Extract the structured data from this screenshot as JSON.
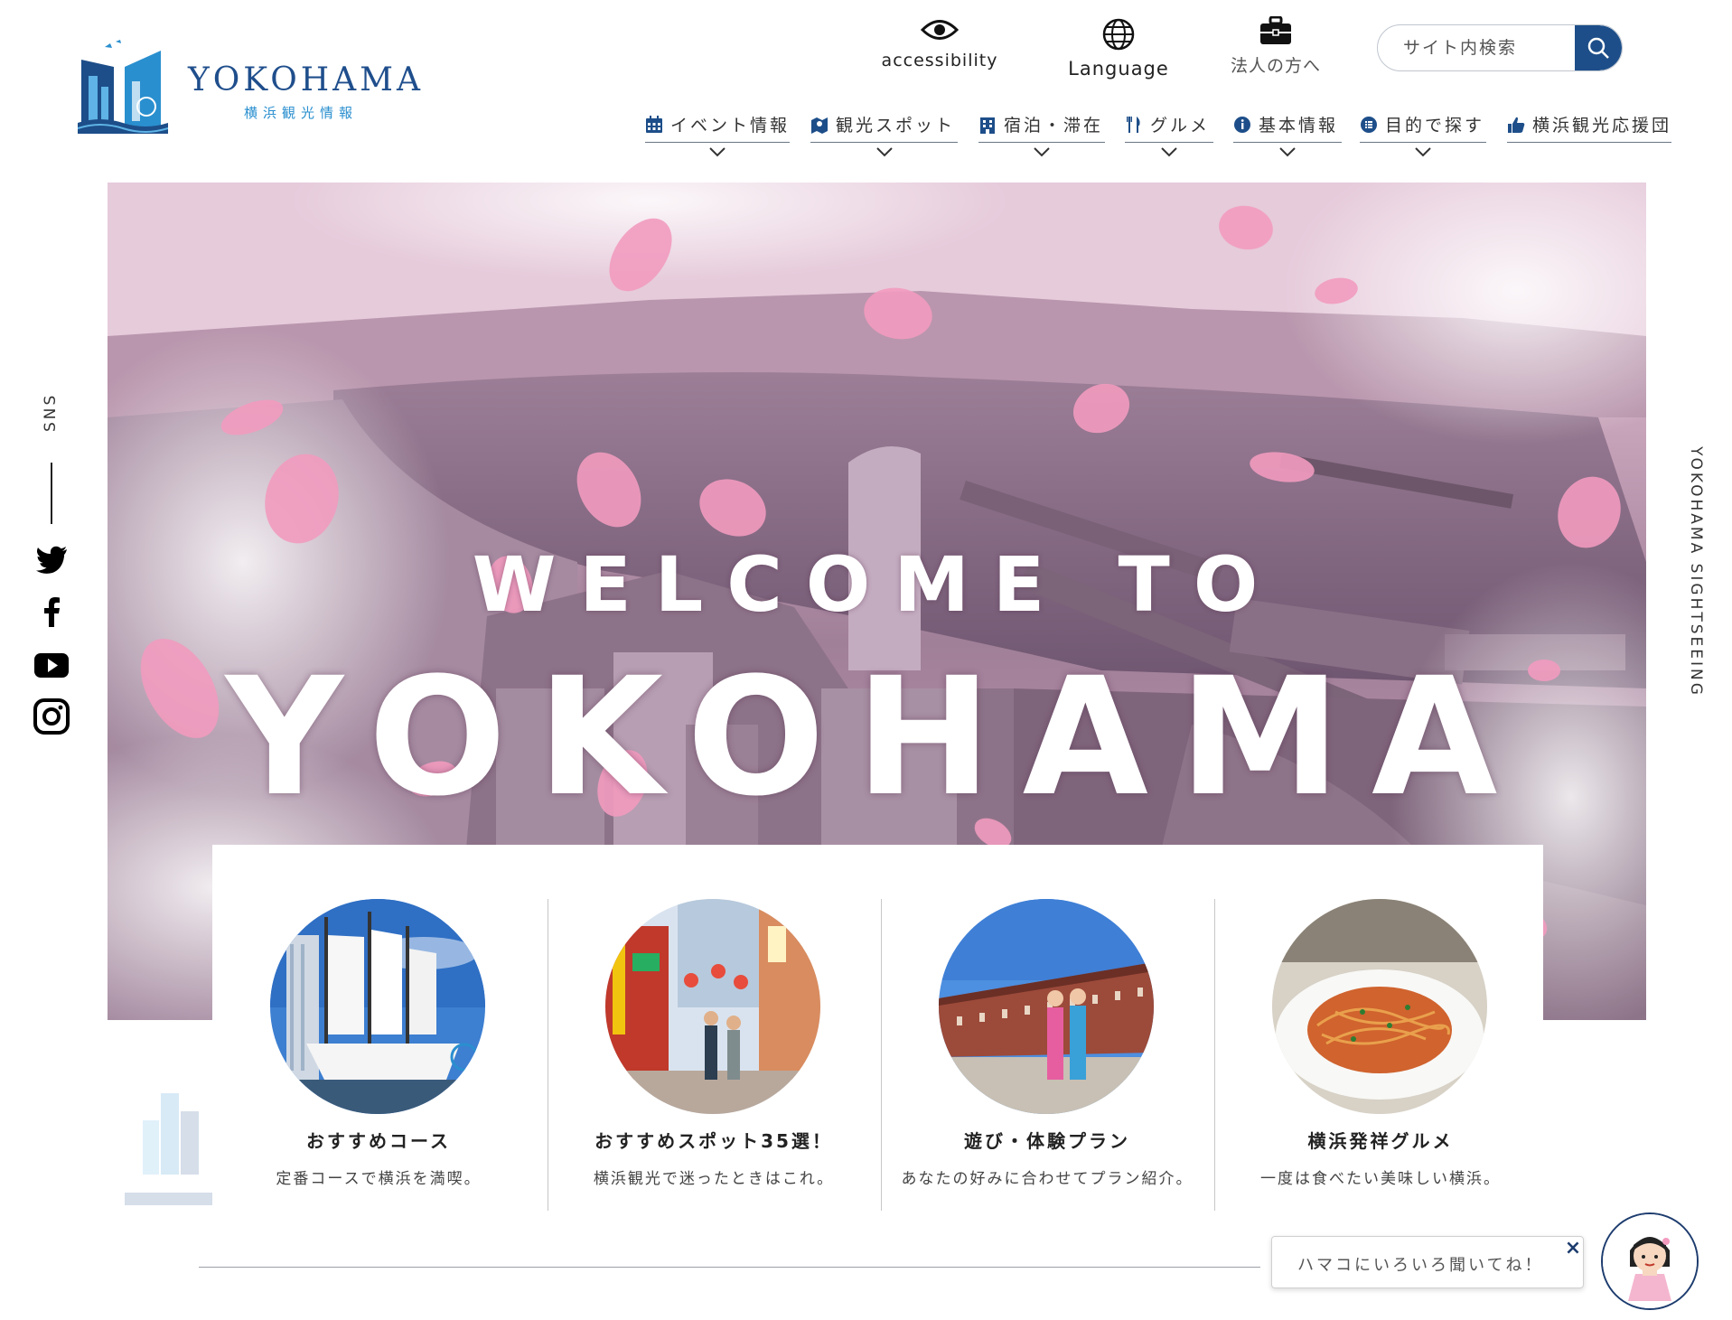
{
  "header": {
    "logo_title": "YOKOHAMA",
    "logo_subtitle": "横浜観光情報",
    "utility": {
      "accessibility": "accessibility",
      "language": "Language",
      "corporate": "法人の方へ"
    },
    "search": {
      "placeholder": "サイト内検索"
    }
  },
  "nav": {
    "items": [
      {
        "label": "イベント情報",
        "icon": "calendar-icon"
      },
      {
        "label": "観光スポット",
        "icon": "map-icon"
      },
      {
        "label": "宿泊・滞在",
        "icon": "hotel-icon"
      },
      {
        "label": "グルメ",
        "icon": "cutlery-icon"
      },
      {
        "label": "基本情報",
        "icon": "info-icon"
      },
      {
        "label": "目的で探す",
        "icon": "list-icon"
      },
      {
        "label": "横浜観光応援団",
        "icon": "thumbs-up-icon"
      }
    ]
  },
  "hero": {
    "welcome": "WELCOME TO",
    "city": "YOKOHAMA"
  },
  "side": {
    "sns_label": "SNS",
    "sns_icons": [
      "twitter-icon",
      "facebook-icon",
      "youtube-icon",
      "instagram-icon"
    ],
    "right_text": "YOKOHAMA SIGHTSEEING"
  },
  "cards": [
    {
      "title": "おすすめコース",
      "desc": "定番コースで横浜を満喫。"
    },
    {
      "title": "おすすめスポット35選！",
      "desc": "横浜観光で迷ったときはこれ。"
    },
    {
      "title": "遊び・体験プラン",
      "desc": "あなたの好みに合わせてプラン紹介。"
    },
    {
      "title": "横浜発祥グルメ",
      "desc": "一度は食べたい美味しい横浜。"
    }
  ],
  "chat": {
    "prompt": "ハマコにいろいろ聞いてね！",
    "close": "×"
  },
  "colors": {
    "brand_navy": "#1d4e89",
    "brand_blue": "#2a8fcf",
    "petal_pink": "#f29bbf"
  }
}
